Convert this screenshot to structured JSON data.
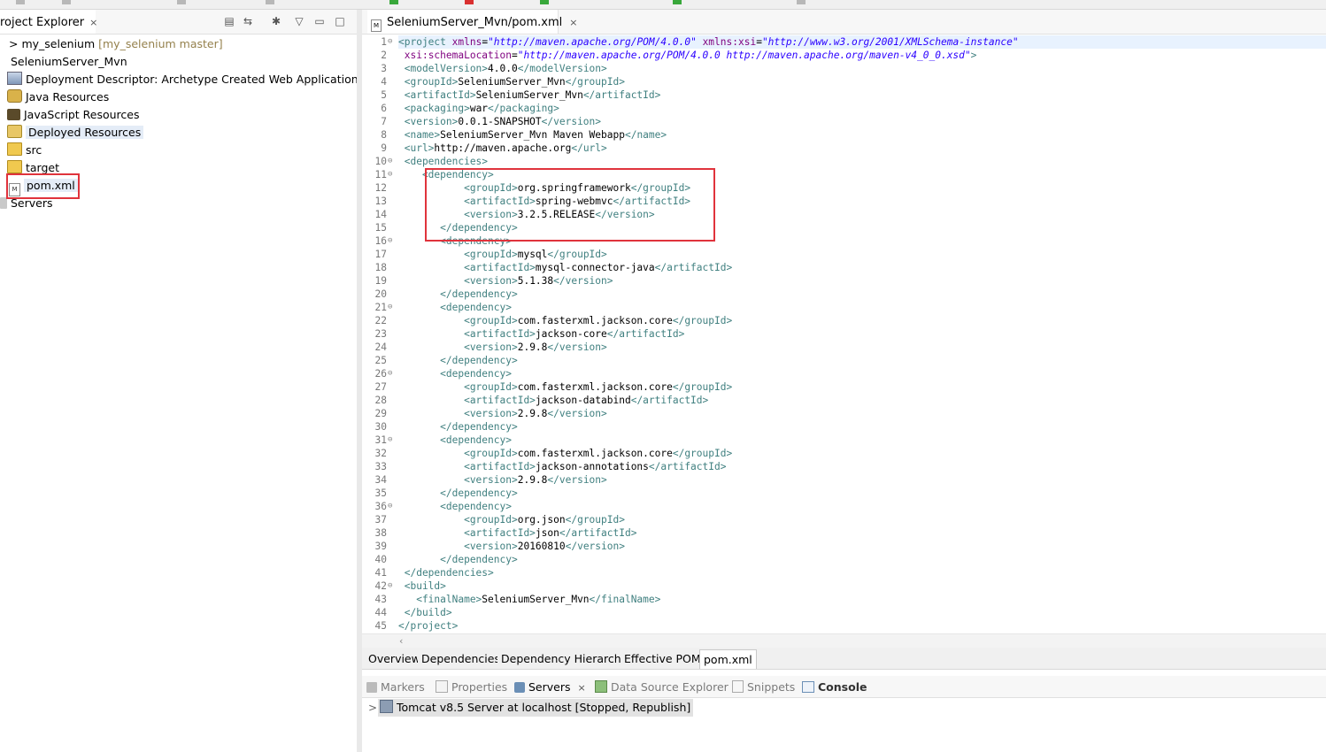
{
  "colors": {
    "accent_red": "#e0333c",
    "xml_tag": "#3f7f7f",
    "xml_attr": "#7f007f",
    "xml_value": "#2a00ff"
  },
  "project_explorer": {
    "tab_label": "roject Explorer",
    "close_icon": "×",
    "tree": [
      {
        "label": "my_selenium",
        "prefix": "> ",
        "suffix": "[my_selenium master]",
        "icon": "git-project-icon"
      },
      {
        "label": "SeleniumServer_Mvn",
        "icon": "web-project-icon"
      },
      {
        "label": "Deployment Descriptor: Archetype Created Web Applicationr",
        "icon": "deployment-descriptor-icon"
      },
      {
        "label": "Java Resources",
        "icon": "java-resources-icon"
      },
      {
        "label": "JavaScript Resources",
        "icon": "javascript-resources-icon"
      },
      {
        "label": "Deployed Resources",
        "icon": "deployed-resources-icon"
      },
      {
        "label": "src",
        "icon": "folder-icon"
      },
      {
        "label": "target",
        "icon": "folder-icon"
      },
      {
        "label": "pom.xml",
        "icon": "maven-file-icon"
      },
      {
        "label": "Servers",
        "icon": "servers-folder-icon"
      }
    ]
  },
  "editor": {
    "tab_label": "SeleniumServer_Mvn/pom.xml",
    "close_icon": "×",
    "lines": [
      "1",
      "2",
      "3",
      "4",
      "5",
      "6",
      "7",
      "8",
      "9",
      "10",
      "11",
      "12",
      "13",
      "14",
      "15",
      "16",
      "17",
      "18",
      "19",
      "20",
      "21",
      "22",
      "23",
      "24",
      "25",
      "26",
      "27",
      "28",
      "29",
      "30",
      "31",
      "32",
      "33",
      "34",
      "35",
      "36",
      "37",
      "38",
      "39",
      "40",
      "41",
      "42",
      "43",
      "44",
      "45"
    ],
    "fold_lines": [
      1,
      10,
      11,
      16,
      21,
      26,
      31,
      36,
      42
    ],
    "code": [
      [
        [
          "t",
          "<project "
        ],
        [
          "a",
          "xmlns"
        ],
        [
          "",
          "="
        ],
        [
          "v",
          "\"http://maven.apache.org/POM/4.0.0\""
        ],
        [
          "",
          " "
        ],
        [
          "a",
          "xmlns:xsi"
        ],
        [
          "",
          "="
        ],
        [
          "v",
          "\"http://www.w3.org/2001/XMLSchema-instance\""
        ]
      ],
      [
        [
          "",
          " "
        ],
        [
          "a",
          "xsi:schemaLocation"
        ],
        [
          "",
          "="
        ],
        [
          "v",
          "\"http://maven.apache.org/POM/4.0.0 http://maven.apache.org/maven-v4_0_0.xsd\""
        ],
        [
          "t",
          ">"
        ]
      ],
      [
        [
          "t",
          " <modelVersion>"
        ],
        [
          "",
          "4.0.0"
        ],
        [
          "t",
          "</modelVersion>"
        ]
      ],
      [
        [
          "t",
          " <groupId>"
        ],
        [
          "",
          "SeleniumServer_Mvn"
        ],
        [
          "t",
          "</groupId>"
        ]
      ],
      [
        [
          "t",
          " <artifactId>"
        ],
        [
          "",
          "SeleniumServer_Mvn"
        ],
        [
          "t",
          "</artifactId>"
        ]
      ],
      [
        [
          "t",
          " <packaging>"
        ],
        [
          "",
          "war"
        ],
        [
          "t",
          "</packaging>"
        ]
      ],
      [
        [
          "t",
          " <version>"
        ],
        [
          "",
          "0.0.1-SNAPSHOT"
        ],
        [
          "t",
          "</version>"
        ]
      ],
      [
        [
          "t",
          " <name>"
        ],
        [
          "",
          "SeleniumServer_Mvn Maven Webapp"
        ],
        [
          "t",
          "</name>"
        ]
      ],
      [
        [
          "t",
          " <url>"
        ],
        [
          "",
          "http://maven.apache.org"
        ],
        [
          "t",
          "</url>"
        ]
      ],
      [
        [
          "t",
          " <dependencies>"
        ]
      ],
      [
        [
          "t",
          "    <dependency>"
        ]
      ],
      [
        [
          "t",
          "           <groupId>"
        ],
        [
          "",
          "org.springframework"
        ],
        [
          "t",
          "</groupId>"
        ]
      ],
      [
        [
          "t",
          "           <artifactId>"
        ],
        [
          "",
          "spring-webmvc"
        ],
        [
          "t",
          "</artifactId>"
        ]
      ],
      [
        [
          "t",
          "           <version>"
        ],
        [
          "",
          "3.2.5.RELEASE"
        ],
        [
          "t",
          "</version>"
        ]
      ],
      [
        [
          "t",
          "       </dependency>"
        ]
      ],
      [
        [
          "t",
          "       <dependency>"
        ]
      ],
      [
        [
          "t",
          "           <groupId>"
        ],
        [
          "",
          "mysql"
        ],
        [
          "t",
          "</groupId>"
        ]
      ],
      [
        [
          "t",
          "           <artifactId>"
        ],
        [
          "",
          "mysql-connector-java"
        ],
        [
          "t",
          "</artifactId>"
        ]
      ],
      [
        [
          "t",
          "           <version>"
        ],
        [
          "",
          "5.1.38"
        ],
        [
          "t",
          "</version>"
        ]
      ],
      [
        [
          "t",
          "       </dependency>"
        ]
      ],
      [
        [
          "t",
          "       <dependency>"
        ]
      ],
      [
        [
          "t",
          "           <groupId>"
        ],
        [
          "",
          "com.fasterxml.jackson.core"
        ],
        [
          "t",
          "</groupId>"
        ]
      ],
      [
        [
          "t",
          "           <artifactId>"
        ],
        [
          "",
          "jackson-core"
        ],
        [
          "t",
          "</artifactId>"
        ]
      ],
      [
        [
          "t",
          "           <version>"
        ],
        [
          "",
          "2.9.8"
        ],
        [
          "t",
          "</version>"
        ]
      ],
      [
        [
          "t",
          "       </dependency>"
        ]
      ],
      [
        [
          "t",
          "       <dependency>"
        ]
      ],
      [
        [
          "t",
          "           <groupId>"
        ],
        [
          "",
          "com.fasterxml.jackson.core"
        ],
        [
          "t",
          "</groupId>"
        ]
      ],
      [
        [
          "t",
          "           <artifactId>"
        ],
        [
          "",
          "jackson-databind"
        ],
        [
          "t",
          "</artifactId>"
        ]
      ],
      [
        [
          "t",
          "           <version>"
        ],
        [
          "",
          "2.9.8"
        ],
        [
          "t",
          "</version>"
        ]
      ],
      [
        [
          "t",
          "       </dependency>"
        ]
      ],
      [
        [
          "t",
          "       <dependency>"
        ]
      ],
      [
        [
          "t",
          "           <groupId>"
        ],
        [
          "",
          "com.fasterxml.jackson.core"
        ],
        [
          "t",
          "</groupId>"
        ]
      ],
      [
        [
          "t",
          "           <artifactId>"
        ],
        [
          "",
          "jackson-annotations"
        ],
        [
          "t",
          "</artifactId>"
        ]
      ],
      [
        [
          "t",
          "           <version>"
        ],
        [
          "",
          "2.9.8"
        ],
        [
          "t",
          "</version>"
        ]
      ],
      [
        [
          "t",
          "       </dependency>"
        ]
      ],
      [
        [
          "t",
          "       <dependency>"
        ]
      ],
      [
        [
          "t",
          "           <groupId>"
        ],
        [
          "",
          "org.json"
        ],
        [
          "t",
          "</groupId>"
        ]
      ],
      [
        [
          "t",
          "           <artifactId>"
        ],
        [
          "",
          "json"
        ],
        [
          "t",
          "</artifactId>"
        ]
      ],
      [
        [
          "t",
          "           <version>"
        ],
        [
          "",
          "20160810"
        ],
        [
          "t",
          "</version>"
        ]
      ],
      [
        [
          "t",
          "       </dependency>"
        ]
      ],
      [
        [
          "t",
          " </dependencies>"
        ]
      ],
      [
        [
          "t",
          " <build>"
        ]
      ],
      [
        [
          "t",
          "   <finalName>"
        ],
        [
          "",
          "SeleniumServer_Mvn"
        ],
        [
          "t",
          "</finalName>"
        ]
      ],
      [
        [
          "t",
          " </build>"
        ]
      ],
      [
        [
          "t",
          "</project>"
        ]
      ]
    ]
  },
  "pom_tabs": [
    "Overview",
    "Dependencies",
    "Dependency Hierarchy",
    "Effective POM",
    "pom.xml"
  ],
  "pom_active_tab": "pom.xml",
  "bottom_tabs": [
    {
      "label": "Markers",
      "icon": "markers-icon"
    },
    {
      "label": "Properties",
      "icon": "properties-icon"
    },
    {
      "label": "Servers",
      "icon": "servers-icon",
      "active": true,
      "close": "×"
    },
    {
      "label": "Data Source Explorer",
      "icon": "data-source-icon"
    },
    {
      "label": "Snippets",
      "icon": "snippets-icon"
    },
    {
      "label": "Console",
      "icon": "console-icon",
      "bold": true
    }
  ],
  "servers": {
    "expander": ">",
    "entry": "Tomcat v8.5 Server at localhost  [Stopped, Republish]"
  }
}
